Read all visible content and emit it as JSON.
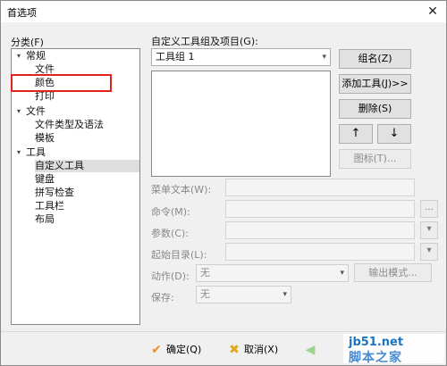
{
  "window": {
    "title": "首选项",
    "close_glyph": "✕"
  },
  "category": {
    "label": "分类(F)",
    "tree": [
      {
        "label": "常规",
        "expanded": true
      },
      {
        "label": "文件"
      },
      {
        "label": "颜色"
      },
      {
        "label": "打印"
      },
      {
        "label": "文件",
        "expanded": true
      },
      {
        "label": "文件类型及语法"
      },
      {
        "label": "模板"
      },
      {
        "label": "工具",
        "expanded": true
      },
      {
        "label": "自定义工具",
        "selected": true
      },
      {
        "label": "键盘"
      },
      {
        "label": "拼写检查"
      },
      {
        "label": "工具栏"
      },
      {
        "label": "布局"
      }
    ]
  },
  "toolgroup": {
    "label": "自定义工具组及项目(G):",
    "selected": "工具组 1"
  },
  "buttons": {
    "group_name": "组名(Z)",
    "add_tool": "添加工具(J)>>",
    "delete": "删除(S)",
    "up": "↑",
    "down": "↓",
    "icon": "图标(T)..."
  },
  "fields": {
    "menu_text": "菜单文本(W):",
    "command": "命令(M):",
    "params": "参数(C):",
    "start_dir": "起始目录(L):",
    "action": "动作(D):",
    "action_value": "无",
    "save": "保存:",
    "save_value": "无",
    "output_mode": "输出模式...",
    "browse": "..."
  },
  "footer": {
    "ok": "确定(Q)",
    "cancel": "取消(X)"
  },
  "watermark": {
    "line1": "jb51.net",
    "line2": "脚本之家"
  },
  "colors": {
    "accent_red": "#e2231a",
    "ok_check": "#f28c1e",
    "cancel_x": "#e0a91c"
  }
}
